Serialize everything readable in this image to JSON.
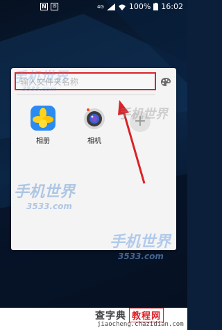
{
  "status_bar": {
    "icons_left": [
      "N",
      "mail"
    ],
    "network_label": "4G",
    "battery": "100%",
    "time": "16:02"
  },
  "folder_dialog": {
    "name_placeholder": "输入文件夹名称",
    "palette_icon": "palette-icon",
    "apps": [
      {
        "label": "相册",
        "icon": "gallery-icon"
      },
      {
        "label": "相机",
        "icon": "camera-icon"
      }
    ]
  },
  "watermarks": [
    {
      "main": "手机世界",
      "sub": "3533.com"
    }
  ],
  "footer": {
    "brand": "查字典",
    "tag": "教程网",
    "url": "jiaocheng.chazidian.com"
  },
  "colors": {
    "highlight_box": "#d92328",
    "arrow": "#d92328"
  }
}
